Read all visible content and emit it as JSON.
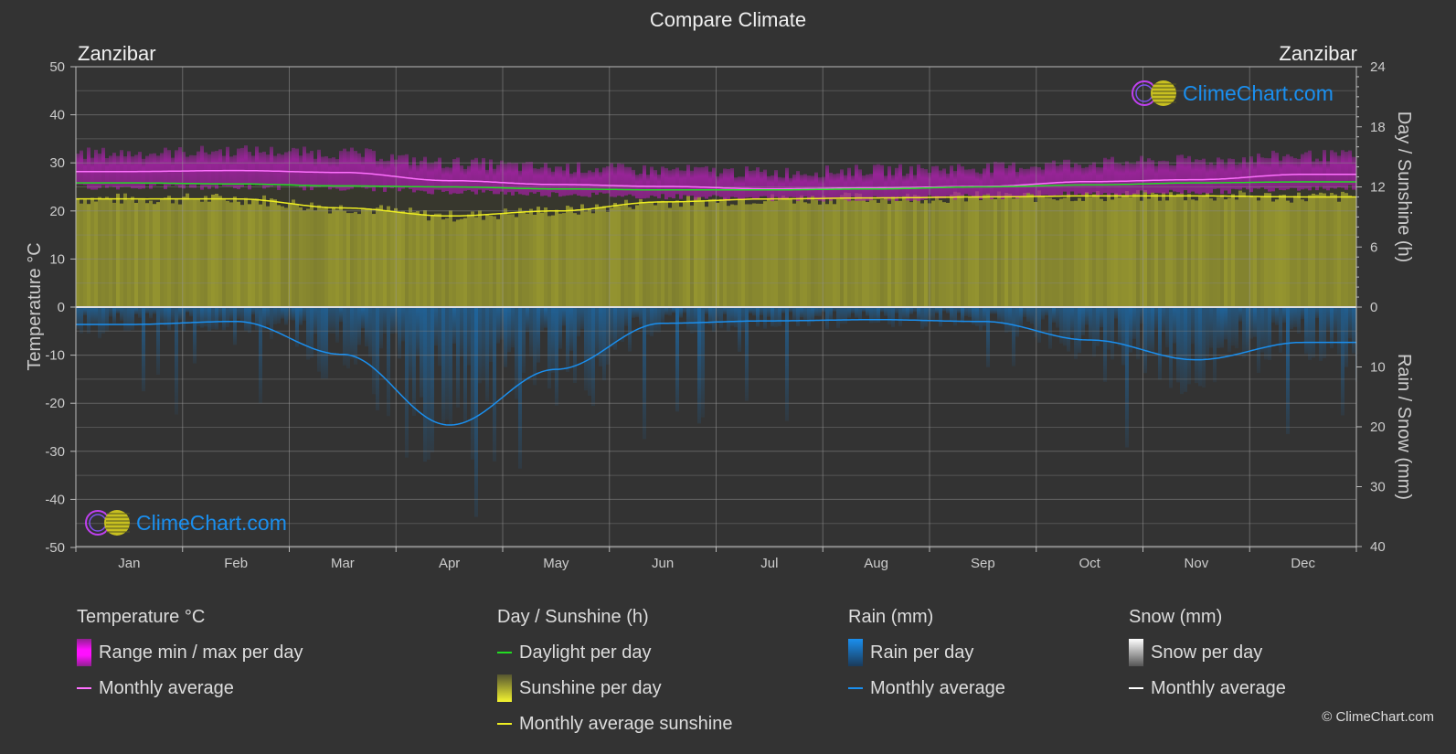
{
  "title": "Compare Climate",
  "location_left": "Zanzibar",
  "location_right": "Zanzibar",
  "watermark": "ClimeChart.com",
  "copyright": "© ClimeChart.com",
  "colors": {
    "background": "#333333",
    "temp_range": "#e020e0",
    "temp_avg": "#ff70ff",
    "daylight": "#22dd22",
    "sunshine_fill": "#9a9a30",
    "sunshine_avg": "#eeee22",
    "rain_fill": "#1a6fb0",
    "rain_avg": "#1a8fef",
    "snow_avg": "#ffffff"
  },
  "legend": {
    "temperature": {
      "title": "Temperature °C",
      "range": "Range min / max per day",
      "avg": "Monthly average"
    },
    "sunshine": {
      "title": "Day / Sunshine (h)",
      "daylight": "Daylight per day",
      "sunshine": "Sunshine per day",
      "avg": "Monthly average sunshine"
    },
    "rain": {
      "title": "Rain (mm)",
      "per_day": "Rain per day",
      "avg": "Monthly average"
    },
    "snow": {
      "title": "Snow (mm)",
      "per_day": "Snow per day",
      "avg": "Monthly average"
    }
  },
  "chart_data": {
    "type": "line",
    "title": "Compare Climate",
    "categories": [
      "Jan",
      "Feb",
      "Mar",
      "Apr",
      "May",
      "Jun",
      "Jul",
      "Aug",
      "Sep",
      "Oct",
      "Nov",
      "Dec"
    ],
    "axes": {
      "left": {
        "label": "Temperature °C",
        "range": [
          -50,
          50
        ],
        "ticks": [
          "50",
          "40",
          "30",
          "20",
          "10",
          "0",
          "-10",
          "-20",
          "-30",
          "-40",
          "-50"
        ]
      },
      "right_top": {
        "label": "Day / Sunshine (h)",
        "range": [
          0,
          24
        ],
        "ticks": [
          "24",
          "18",
          "12",
          "6",
          "0"
        ]
      },
      "right_bottom": {
        "label": "Rain / Snow (mm)",
        "range": [
          0,
          40
        ],
        "ticks": [
          "0",
          "10",
          "20",
          "30",
          "40"
        ]
      }
    },
    "grid": true,
    "series": [
      {
        "name": "Temperature monthly average (°C)",
        "axis": "left",
        "values": [
          28.2,
          28.4,
          28.0,
          26.3,
          25.5,
          25.1,
          24.6,
          24.8,
          25.1,
          26.1,
          26.5,
          27.6
        ]
      },
      {
        "name": "Temperature daily max approx (°C)",
        "axis": "left",
        "values": [
          31.5,
          32.0,
          31.5,
          29.5,
          28.5,
          28.0,
          27.5,
          28.0,
          28.5,
          29.5,
          30.0,
          31.0
        ]
      },
      {
        "name": "Temperature daily min approx (°C)",
        "axis": "left",
        "values": [
          25.0,
          25.0,
          24.8,
          24.0,
          23.5,
          23.0,
          22.5,
          22.5,
          23.0,
          23.5,
          24.0,
          24.8
        ]
      },
      {
        "name": "Daylight per day (h)",
        "axis": "right_top",
        "values": [
          12.4,
          12.3,
          12.1,
          12.0,
          11.8,
          11.7,
          11.7,
          11.8,
          12.0,
          12.2,
          12.4,
          12.5
        ]
      },
      {
        "name": "Monthly average sunshine (h)",
        "axis": "right_top",
        "values": [
          10.8,
          10.8,
          9.9,
          9.1,
          9.6,
          10.5,
          10.8,
          10.9,
          11.0,
          11.1,
          11.1,
          11.0
        ]
      },
      {
        "name": "Rain monthly average (mm)",
        "axis": "right_bottom",
        "values": [
          2.9,
          2.4,
          7.9,
          19.7,
          10.4,
          2.7,
          2.3,
          2.1,
          2.4,
          5.5,
          8.8,
          5.9
        ]
      },
      {
        "name": "Snow monthly average (mm)",
        "axis": "right_bottom",
        "values": [
          0,
          0,
          0,
          0,
          0,
          0,
          0,
          0,
          0,
          0,
          0,
          0
        ]
      }
    ]
  }
}
